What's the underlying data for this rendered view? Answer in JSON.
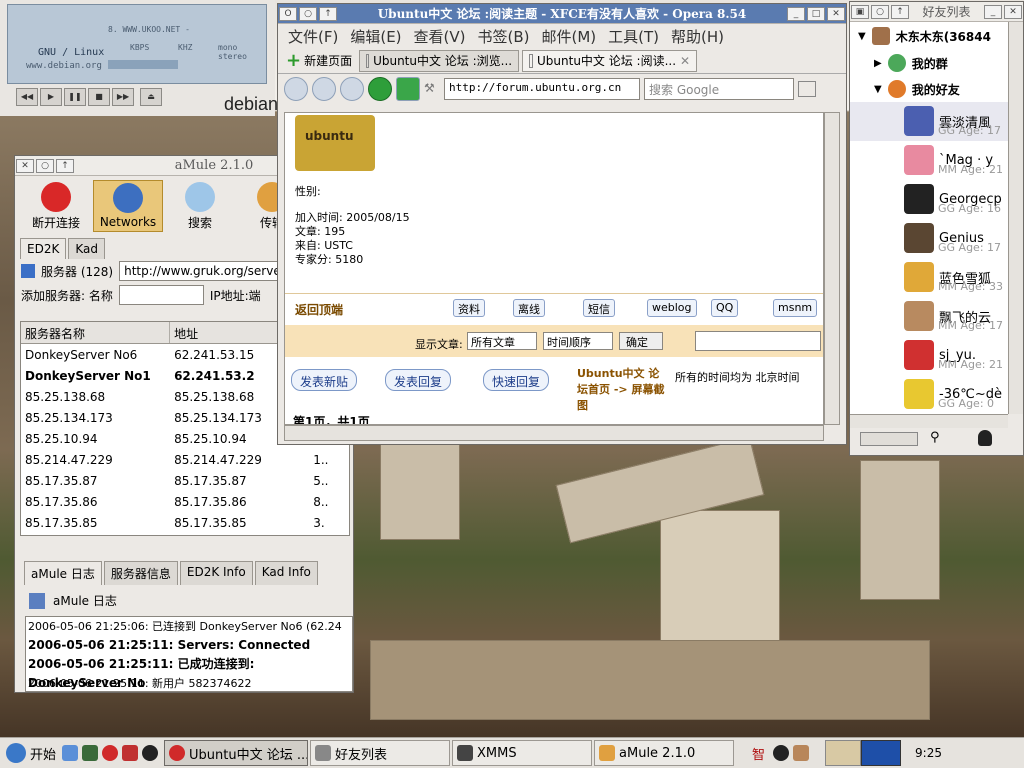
{
  "xmms": {
    "track": "8. WWW.UKOO.NET -",
    "kbps": "KBPS",
    "khz": "KHZ",
    "mode": "mono stereo",
    "site": "www.debian.org",
    "gnu": "GNU / Linux",
    "brand": "debian",
    "buttons": [
      "◀◀",
      "▶",
      "❚❚",
      "■",
      "▶▶",
      "⏏"
    ]
  },
  "amule": {
    "title": "aMule 2.1.0",
    "toolbar": [
      {
        "label": "断开连接"
      },
      {
        "label": "Networks"
      },
      {
        "label": "搜索"
      },
      {
        "label": "传输"
      }
    ],
    "tabs": [
      "ED2K",
      "Kad"
    ],
    "server_label": "服务器 (128)",
    "server_url": "http://www.gruk.org/server",
    "add_label": "添加服务器: 名称",
    "ip_label": "IP地址:端",
    "columns": [
      "服务器名称",
      "地址"
    ],
    "servers": [
      {
        "name": "DonkeyServer No6",
        "addr": "62.241.53.15",
        "extra": ""
      },
      {
        "name": "DonkeyServer No1",
        "addr": "62.241.53.2",
        "extra": ""
      },
      {
        "name": "85.25.138.68",
        "addr": "85.25.138.68",
        "extra": ""
      },
      {
        "name": "85.25.134.173",
        "addr": "85.25.134.173",
        "extra": ""
      },
      {
        "name": "85.25.10.94",
        "addr": "85.25.10.94",
        "extra": ""
      },
      {
        "name": "85.214.47.229",
        "addr": "85.214.47.229",
        "extra": "1.."
      },
      {
        "name": "85.17.35.87",
        "addr": "85.17.35.87",
        "extra": "5.."
      },
      {
        "name": "85.17.35.86",
        "addr": "85.17.35.86",
        "extra": "8.."
      },
      {
        "name": "85.17.35.85",
        "addr": "85.17.35.85",
        "extra": "3."
      }
    ],
    "log_tabs": [
      "aMule 日志",
      "服务器信息",
      "ED2K Info",
      "Kad Info"
    ],
    "log_title": "aMule 日志",
    "log_lines": [
      "2006-05-06 21:25:06: 已连接到 DonkeyServer No6 (62.24",
      "2006-05-06 21:25:11: Servers: Connected",
      "2006-05-06 21:25:11: 已成功连接到: DonkeyServer No",
      "2006-05-06 21:25:11: 新用户 582374622"
    ]
  },
  "opera": {
    "title": "Ubuntu中文 论坛 :阅读主题 - XFCE有没有人喜欢 - Opera 8.54",
    "menu": [
      "文件(F)",
      "编辑(E)",
      "查看(V)",
      "书签(B)",
      "邮件(M)",
      "工具(T)",
      "帮助(H)"
    ],
    "new_page": "新建页面",
    "tabs": [
      "Ubuntu中文 论坛 :浏览...",
      "Ubuntu中文 论坛 :阅读..."
    ],
    "address": "http://forum.ubuntu.org.cn",
    "search": "搜索 Google",
    "avatar_text": "ubuntu",
    "gender": "性别:",
    "join": "加入时间: 2005/08/15",
    "posts": "文章: 195",
    "from": "来自: USTC",
    "score": "专家分: 5180",
    "back": "返回顶端",
    "post_btns": [
      "资料",
      "离线",
      "短信",
      "weblog",
      "QQ",
      "msnm"
    ],
    "show": "显示文章:",
    "sel1": "所有文章",
    "sel2": "时间顺序",
    "ok": "确定",
    "new_post": "发表新贴",
    "reply": "发表回复",
    "quick": "快速回复",
    "forum_path": "Ubuntu中文 论坛首页 -> 屏幕截图",
    "tz": "所有的时间均为 北京时间",
    "page": "第1页，共1页"
  },
  "buddy": {
    "title": "好友列表",
    "me": "木东木东(36844",
    "groups": [
      "我的群",
      "我的好友"
    ],
    "friends": [
      {
        "name": "雲淡清風",
        "status": "GG Age: 17",
        "color": "#4b5fb0"
      },
      {
        "name": "`Mag · y",
        "status": "MM Age: 21",
        "color": "#e88aa0"
      },
      {
        "name": "Georgecp",
        "status": "GG Age: 16",
        "color": "#222222"
      },
      {
        "name": "Genius",
        "status": "GG Age: 17",
        "color": "#5a4632"
      },
      {
        "name": "蓝色雪狐",
        "status": "MM Age: 33",
        "color": "#e0a838"
      },
      {
        "name": "飘飞的云",
        "status": "MM Age: 17",
        "color": "#b88a60"
      },
      {
        "name": "sj_yu.",
        "status": "MM Age: 21",
        "color": "#d03030"
      },
      {
        "name": "-36℃~dè",
        "status": "GG Age: 0",
        "color": "#e8c830"
      }
    ]
  },
  "taskbar": {
    "start": "开始",
    "tasks": [
      "Ubuntu中文 论坛 ...",
      "好友列表",
      "XMMS",
      "aMule 2.1.0"
    ],
    "clock": "9:25",
    "ime": "智"
  }
}
